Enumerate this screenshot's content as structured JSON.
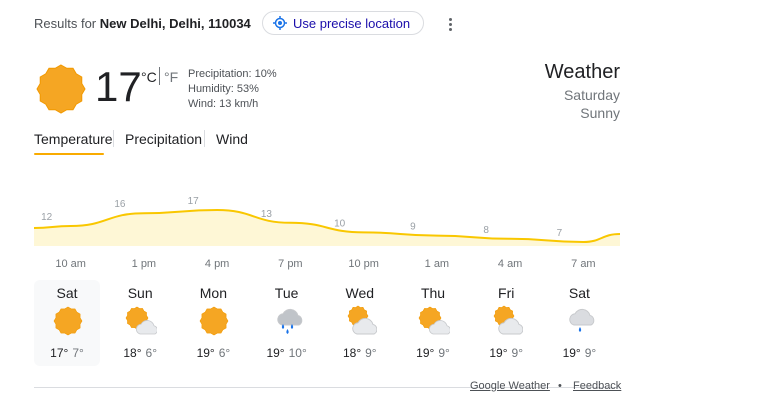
{
  "header": {
    "results_prefix": "Results for",
    "location": "New Delhi, Delhi, 110034",
    "precise_location_label": "Use precise location"
  },
  "current": {
    "temperature": "17",
    "unit_c": "°C",
    "unit_f": "°F",
    "precipitation": "Precipitation: 10%",
    "humidity": "Humidity: 53%",
    "wind": "Wind: 13 km/h",
    "title": "Weather",
    "day": "Saturday",
    "condition": "Sunny",
    "icon": "sunny-icon"
  },
  "tabs": [
    "Temperature",
    "Precipitation",
    "Wind"
  ],
  "chart_data": {
    "type": "area",
    "x": [
      "10 am",
      "1 pm",
      "4 pm",
      "7 pm",
      "10 pm",
      "1 am",
      "4 am",
      "7 am"
    ],
    "values": [
      12,
      16,
      17,
      13,
      10,
      9,
      8,
      7
    ],
    "line_color": "#f9c700",
    "fill_color": "#fef7d6"
  },
  "forecast": [
    {
      "day": "Sat",
      "high": "17°",
      "low": "7°",
      "icon": "sunny-icon"
    },
    {
      "day": "Sun",
      "high": "18°",
      "low": "6°",
      "icon": "partly-cloudy-icon"
    },
    {
      "day": "Mon",
      "high": "19°",
      "low": "6°",
      "icon": "sunny-icon"
    },
    {
      "day": "Tue",
      "high": "19°",
      "low": "10°",
      "icon": "rain-icon"
    },
    {
      "day": "Wed",
      "high": "18°",
      "low": "9°",
      "icon": "mostly-cloudy-icon"
    },
    {
      "day": "Thu",
      "high": "19°",
      "low": "9°",
      "icon": "partly-cloudy-icon"
    },
    {
      "day": "Fri",
      "high": "19°",
      "low": "9°",
      "icon": "mostly-cloudy-icon"
    },
    {
      "day": "Sat",
      "high": "19°",
      "low": "9°",
      "icon": "cloudy-rain-icon"
    }
  ],
  "footer": {
    "google_weather": "Google Weather",
    "separator": "•",
    "feedback": "Feedback"
  }
}
